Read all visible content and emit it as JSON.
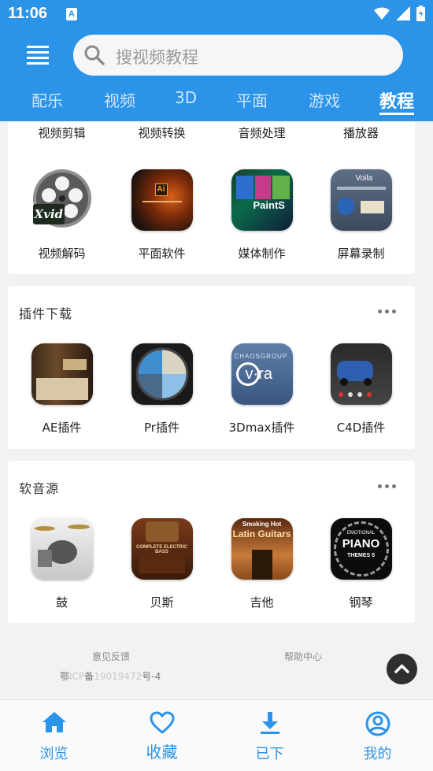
{
  "status_bar": {
    "time": "11:06",
    "notification_badge": "A"
  },
  "header": {
    "search_placeholder": "搜视频教程",
    "tabs": [
      {
        "label": "配乐"
      },
      {
        "label": "视频"
      },
      {
        "label": "3D"
      },
      {
        "label": "平面"
      },
      {
        "label": "游戏"
      },
      {
        "label": "教程",
        "active": true
      }
    ]
  },
  "software_section": {
    "top_row_labels": [
      "视频剪辑",
      "视频转换",
      "音频处理",
      "播放器"
    ],
    "items": [
      {
        "label": "视频解码",
        "icon": "film-reel-xvid-icon",
        "thumb_text": "Xvid"
      },
      {
        "label": "平面软件",
        "icon": "adobe-illustrator-icon",
        "thumb_text": "Ai"
      },
      {
        "label": "媒体制作",
        "icon": "paintshop-icon",
        "thumb_text": "PaintS"
      },
      {
        "label": "屏幕录制",
        "icon": "voila-screen-capture-icon",
        "thumb_text": "Voila"
      }
    ]
  },
  "plugins_section": {
    "title": "插件下载",
    "items": [
      {
        "label": "AE插件",
        "icon": "ae-plugin-icon"
      },
      {
        "label": "Pr插件",
        "icon": "pr-plugin-icon"
      },
      {
        "label": "3Dmax插件",
        "icon": "vray-plugin-icon",
        "thumb_text": "v·ra",
        "thumb_caption": "CHAOSGROUP"
      },
      {
        "label": "C4D插件",
        "icon": "c4d-plugin-icon"
      }
    ]
  },
  "sound_section": {
    "title": "软音源",
    "items": [
      {
        "label": "鼓",
        "icon": "drum-kit-icon"
      },
      {
        "label": "贝斯",
        "icon": "electric-bass-icon",
        "thumb_caption": "COMPLETE ELECTRIC BASS"
      },
      {
        "label": "吉他",
        "icon": "latin-guitar-icon",
        "thumb_caption": "Smoking Hot",
        "thumb_text": "Latin Guitars"
      },
      {
        "label": "钢琴",
        "icon": "piano-themes-icon",
        "thumb_caption": "EMOTIONAL",
        "thumb_text": "PIANO",
        "thumb_sub": "THEMES 5"
      }
    ]
  },
  "footer": {
    "feedback": "意见反馈",
    "help": "帮助中心",
    "icp_prefix": "鄂",
    "icp_faded_1": "ICP",
    "icp_mid": "备",
    "icp_faded_2": "19019472",
    "icp_suffix": "号-4"
  },
  "bottom_nav": [
    {
      "label": "浏览",
      "icon": "home-icon"
    },
    {
      "label": "收藏",
      "icon": "heart-icon"
    },
    {
      "label": "已下",
      "icon": "download-icon"
    },
    {
      "label": "我的",
      "icon": "user-icon"
    }
  ],
  "colors": {
    "primary": "#2b93e8",
    "tab_inactive": "#cfe6fb",
    "background": "#f2f2f2"
  }
}
